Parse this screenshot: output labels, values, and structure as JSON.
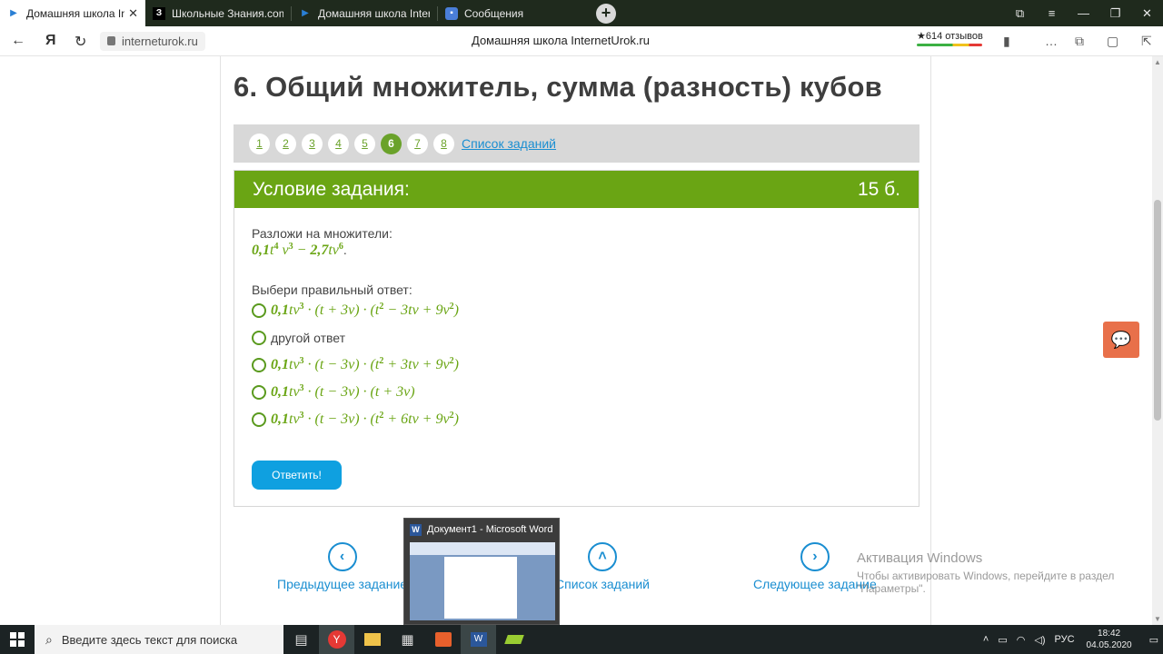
{
  "browser": {
    "tabs": [
      {
        "title": "Домашняя школа Interr",
        "active": true,
        "icon": "play-icon"
      },
      {
        "title": "Школьные Знания.com - E",
        "active": false,
        "icon": "znanija-icon"
      },
      {
        "title": "Домашняя школа Internet",
        "active": false,
        "icon": "play-icon"
      },
      {
        "title": "Сообщения",
        "active": false,
        "icon": "message-icon"
      }
    ],
    "address": "interneturok.ru",
    "page_title": "Домашняя школа InternetUrok.ru",
    "reviews": "★614 отзывов"
  },
  "page": {
    "heading": "6. Общий множитель, сумма (разность) кубов",
    "pager": {
      "pages": [
        "1",
        "2",
        "3",
        "4",
        "5",
        "6",
        "7",
        "8"
      ],
      "current": "6",
      "tasks_link": "Список заданий"
    },
    "task": {
      "header_title": "Условие задания:",
      "points": "15 б.",
      "instruction": "Разложи на множители:",
      "choose_label": "Выбери правильный ответ:",
      "other_answer": "другой ответ",
      "submit": "Ответить!"
    },
    "nav": {
      "prev": "Предыдущее задание",
      "list": "Список заданий",
      "next": "Следующее задание"
    }
  },
  "watermark": {
    "title": "Активация Windows",
    "line1": "Чтобы активировать Windows, перейдите в раздел",
    "line2": "\"Параметры\"."
  },
  "preview": {
    "title": "Документ1 - Microsoft Word"
  },
  "taskbar": {
    "search_placeholder": "Введите здесь текст для поиска",
    "lang": "РУС",
    "time": "18:42",
    "date": "04.05.2020"
  },
  "colors": {
    "accent_green": "#6aa514",
    "link_blue": "#1a8ed1",
    "button_blue": "#0fa0e0"
  }
}
